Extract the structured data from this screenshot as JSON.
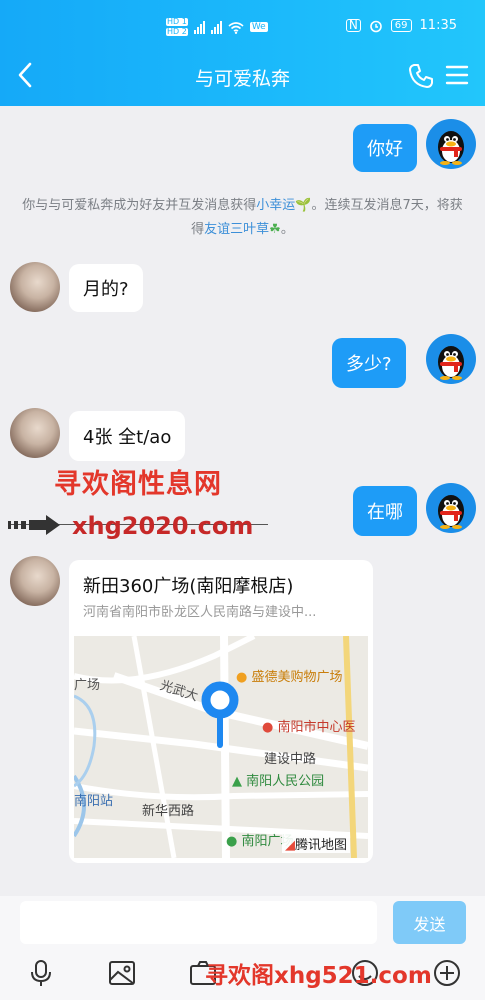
{
  "status_bar": {
    "time": "11:35",
    "battery": "69"
  },
  "header": {
    "title": "与可爱私奔"
  },
  "messages": {
    "m1": "你好",
    "m2": "月的?",
    "m3": "多少?",
    "m4": "4张 全t/ao",
    "m5": "在哪"
  },
  "system_message": {
    "part1": "你与与可爱私奔成为好友并互发消息获得",
    "link1": "小幸运",
    "part2": "。连续互发消息7天，将获得",
    "link2": "友谊三叶草",
    "part3": "。"
  },
  "watermark": {
    "site_name": "寻欢阁性息网",
    "url": "xhg2020.com",
    "bottom": "寻欢阁xhg521.com"
  },
  "location": {
    "name": "新田360广场(南阳摩根店)",
    "address": "河南省南阳市卧龙区人民南路与建设中...",
    "map_labels": {
      "shopping": "盛德美购物广场",
      "center": "南阳市中心医",
      "road1": "光武大",
      "road2": "建设中路",
      "park": "南阳人民公园",
      "station": "南阳站",
      "road3": "新华西路",
      "plaza": "南阳广场",
      "guang": "广场",
      "brand": "腾讯地图"
    }
  },
  "input_bar": {
    "send_label": "发送"
  },
  "colors": {
    "accent": "#1e9cf7",
    "header": "#1bb5fa"
  }
}
